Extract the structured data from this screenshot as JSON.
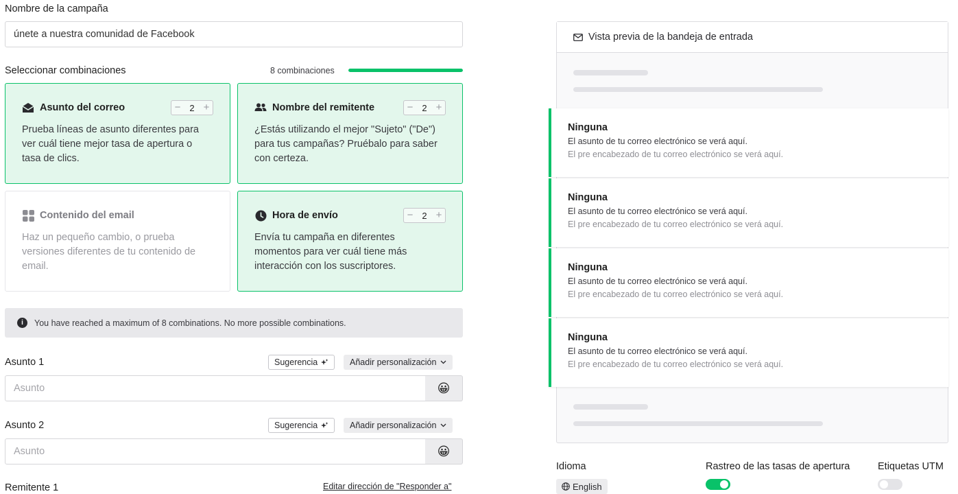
{
  "campaign": {
    "name_label": "Nombre de la campaña",
    "name_value": "únete a nuestra comunidad de Facebook"
  },
  "combinations": {
    "title": "Seleccionar combinaciones",
    "count_label": "8 combinaciones",
    "progress": 1.0,
    "cards": [
      {
        "title": "Asunto del correo",
        "description": "Prueba líneas de asunto diferentes para ver cuál tiene mejor tasa de apertura o tasa de clics.",
        "value": "2",
        "selected": true,
        "icon": "envelope-open-icon"
      },
      {
        "title": "Nombre del remitente",
        "description": "¿Estás utilizando el mejor \"Sujeto\" (\"De\") para tus campañas? Pruébalo para saber con certeza.",
        "value": "2",
        "selected": true,
        "icon": "users-icon"
      },
      {
        "title": "Contenido del email",
        "description": "Haz un pequeño cambio, o prueba versiones diferentes de tu contenido de email.",
        "selected": false,
        "icon": "grid-icon"
      },
      {
        "title": "Hora de envío",
        "description": "Envía tu campaña en diferentes momentos para ver cuál tiene más interacción con los suscriptores.",
        "value": "2",
        "selected": true,
        "icon": "clock-icon"
      }
    ],
    "stepper_minus": "−",
    "stepper_plus": "+"
  },
  "notice": {
    "text": "You have reached a maximum of 8 combinations. No more possible combinations.",
    "icon_glyph": "i"
  },
  "subjects": [
    {
      "label": "Asunto 1",
      "placeholder": "Asunto",
      "suggest_label": "Sugerencia",
      "personalize_label": "Añadir personalización",
      "emoji": "😀"
    },
    {
      "label": "Asunto 2",
      "placeholder": "Asunto",
      "suggest_label": "Sugerencia",
      "personalize_label": "Añadir personalización",
      "emoji": "😀"
    }
  ],
  "sender": {
    "label": "Remitente 1",
    "reply_link": "Editar dirección de \"Responder a\""
  },
  "preview": {
    "title": "Vista previa de la bandeja de entrada",
    "rows": [
      {
        "name": "Ninguna",
        "subject": "El asunto de tu correo electrónico se verá aquí.",
        "preheader": "El pre encabezado de tu correo electrónico se verá aquí."
      },
      {
        "name": "Ninguna",
        "subject": "El asunto de tu correo electrónico se verá aquí.",
        "preheader": "El pre encabezado de tu correo electrónico se verá aquí."
      },
      {
        "name": "Ninguna",
        "subject": "El asunto de tu correo electrónico se verá aquí.",
        "preheader": "El pre encabezado de tu correo electrónico se verá aquí."
      },
      {
        "name": "Ninguna",
        "subject": "El asunto de tu correo electrónico se verá aquí.",
        "preheader": "El pre encabezado de tu correo electrónico se verá aquí."
      }
    ]
  },
  "settings": {
    "language_label": "Idioma",
    "language_value": "English",
    "open_tracking_label": "Rastreo de las tasas de apertura",
    "open_tracking_on": true,
    "utm_label": "Etiquetas UTM",
    "utm_on": false
  },
  "colors": {
    "accent": "#09c269",
    "card_bg": "#e3f7ec"
  }
}
